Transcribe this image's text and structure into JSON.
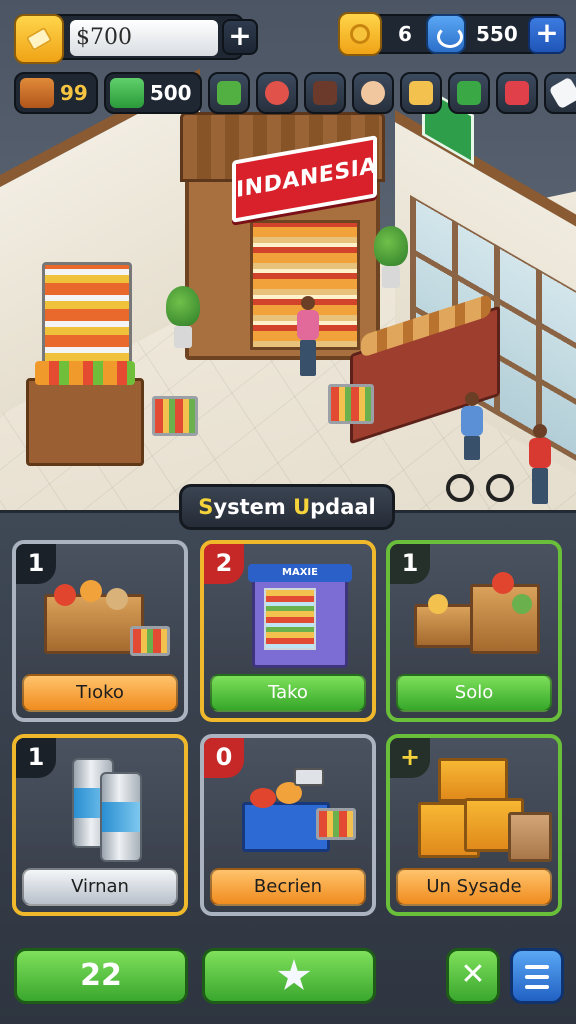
{
  "hud": {
    "cash_value": "$700",
    "coins_value": "6",
    "gems_value": "550",
    "resource_wood": "99",
    "resource_cash": "500"
  },
  "store": {
    "sign_text": "INDANESIA"
  },
  "panel": {
    "title_first": "S",
    "title_ystem": "ystem ",
    "title_u": "U",
    "title_rest": "pdaal",
    "cards": [
      {
        "level": "1",
        "label": "Tıoko"
      },
      {
        "level": "2",
        "label": "Tako"
      },
      {
        "level": "1",
        "label": "Solo"
      },
      {
        "level": "1",
        "label": "Virnan"
      },
      {
        "level": "0",
        "label": "Becrien"
      },
      {
        "level": "+",
        "label": "Un Sysade"
      }
    ]
  },
  "bottom": {
    "count_label": "22",
    "close_label": "✕"
  },
  "vending_sign": "MAXIE"
}
